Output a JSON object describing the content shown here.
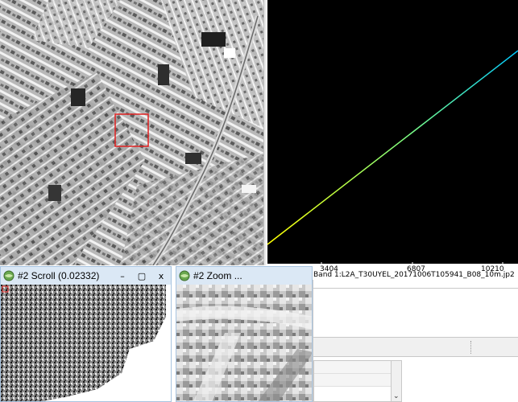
{
  "scroll_window": {
    "title": "#2 Scroll (0.02332)",
    "minimize": "–",
    "maximize": "▢",
    "close": "x"
  },
  "zoom_window": {
    "title": "#2 Zoom ..."
  },
  "plot": {
    "x_ticks": [
      "3404",
      "6807",
      "10210"
    ],
    "band_label": "Band 1:L2A_T30UYEL_20171006T105941_B08_10m.jp2",
    "line_colors": [
      "#ffff00",
      "#00c8ff"
    ]
  },
  "colors": {
    "plot_background": "#000000",
    "selection_box": "#e02020",
    "titlebar": "#dbe8f5"
  },
  "icons": {
    "app": "envi-globe-icon",
    "dropdown": "chevron-down-icon"
  }
}
